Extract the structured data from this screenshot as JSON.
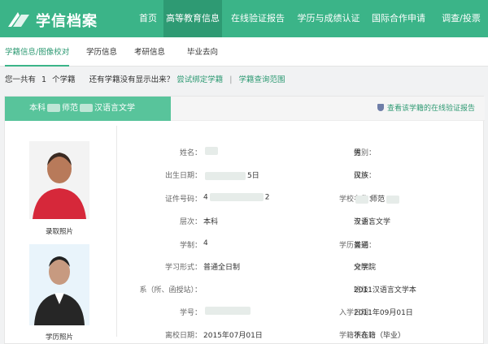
{
  "header": {
    "logo_text": "学信档案",
    "nav": [
      "首页",
      "高等教育信息",
      "在线验证报告",
      "学历与成绩认证",
      "国际合作申请",
      "调查/投票"
    ]
  },
  "subnav": [
    "学籍信息/图像校对",
    "学历信息",
    "考研信息",
    "毕业去向"
  ],
  "summary": {
    "prefix": "您一共有",
    "count": "1",
    "suffix": "个学籍",
    "question": "还有学籍没有显示出来？",
    "bind_link": "尝试绑定学籍",
    "sep": "|",
    "range_link": "学籍查询范围"
  },
  "card": {
    "tag_a": "本科",
    "tag_b": "师范",
    "tag_c": "汉语言文学",
    "verify_link": "查看该学籍的在线验证报告"
  },
  "photos": {
    "admission_caption": "录取照片",
    "degree_caption": "学历照片"
  },
  "info": {
    "name_label": "姓名：",
    "name_value": "",
    "gender_label": "性别：",
    "gender_value": "男",
    "birth_label": "出生日期：",
    "birth_value": "5日",
    "ethnicity_label": "民族：",
    "ethnicity_value": "汉族",
    "id_label": "证件号码：",
    "id_value_a": "4",
    "id_value_b": "2",
    "school_label": "学校名称：",
    "school_value": "师范",
    "level_label": "层次：",
    "level_value": "本科",
    "major_label": "专业：",
    "major_value": "汉语言文学",
    "duration_label": "学制：",
    "duration_value": "4",
    "category_label": "学历类别：",
    "category_value": "普通",
    "form_label": "学习形式：",
    "form_value": "普通全日制",
    "branch_label": "分院：",
    "branch_value": "文学院",
    "dept_label": "系（所、函授站）：",
    "dept_value": "",
    "class_label": "班级：",
    "class_value": "2011汉语言文学本",
    "student_no_label": "学号：",
    "student_no_value": "",
    "enroll_label": "入学日期：",
    "enroll_value": "2011年09月01日",
    "leave_label": "离校日期：",
    "leave_value": "2015年07月01日",
    "status_label": "学籍状态：",
    "status_value": "不在籍（毕业）"
  },
  "colors": {
    "brand_green": "#3bb488",
    "active_green": "#2e9a73",
    "tag_green": "#58c49b"
  }
}
